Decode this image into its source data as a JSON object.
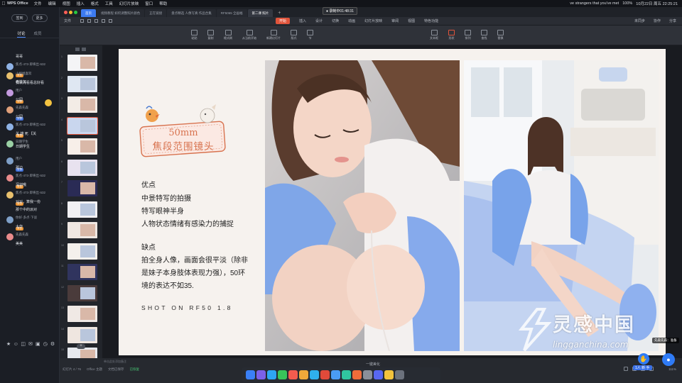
{
  "menubar": {
    "app_name": "WPS Office",
    "items": [
      "文件",
      "编辑",
      "视图",
      "插入",
      "格式",
      "工具",
      "幻灯片放映",
      "窗口",
      "帮助"
    ],
    "now_playing": "ve strangers that you've met",
    "battery": "100%",
    "clock": "10月22日 周五 22:25:21"
  },
  "sidebar": {
    "btn_left": "签到",
    "btn_right": "更多",
    "tabs": [
      "讨论",
      "成员"
    ],
    "messages": [
      {
        "user": "",
        "badge": "",
        "msg": "哥哥"
      },
      {
        "user": "焦点·473·即将出·632",
        "badge": "学员",
        "msg": "老铁加"
      },
      {
        "user": "小姐姐喜欢",
        "badge": "",
        "msg": ""
      },
      {
        "user": "",
        "badge": "",
        "msg": "我就先看看总好看"
      },
      {
        "user": "用户",
        "badge": "学员",
        "msg": ""
      },
      {
        "user": "",
        "badge": "",
        "msg": "公园"
      },
      {
        "user": "先森先森",
        "badge": "学员",
        "msg": ""
      },
      {
        "user": "",
        "badge": "",
        "msg": "公园"
      },
      {
        "user": "焦点·473·即将出·632",
        "badge": "学员",
        "msg": ""
      },
      {
        "user": "",
        "badge": "",
        "msg": "关 雄 死 【关"
      },
      {
        "user": "日期学生",
        "badge": "",
        "msg": "日期学生"
      },
      {
        "user": "",
        "badge": "",
        "msg": ""
      },
      {
        "user": "用户",
        "badge": "学员",
        "msg": ""
      },
      {
        "user": "",
        "badge": "",
        "msg": "那边"
      },
      {
        "user": "焦点·473·即将出·632",
        "badge": "学员",
        "msg": ""
      },
      {
        "user": "",
        "badge": "",
        "msg": "深圳哦"
      },
      {
        "user": "焦点·473·即将出·632",
        "badge": "学员",
        "msg": ""
      },
      {
        "user": "",
        "badge": "",
        "msg": "对对，算我一份"
      },
      {
        "user": "",
        "badge": "",
        "msg": "那个中的派对"
      },
      {
        "user": "你好·多点·下谈",
        "badge": "学员",
        "msg": ""
      },
      {
        "user": "",
        "badge": "",
        "msg": "大作"
      },
      {
        "user": "先森先森",
        "badge": "",
        "msg": ""
      },
      {
        "user": "",
        "badge": "",
        "msg": "美美"
      }
    ]
  },
  "tabs": {
    "home": "首页",
    "docs": [
      "视频教程 如何调整照片颜色",
      "正在链接",
      "盘点精选 人像写真 作品合集",
      "RF5065 全画幅",
      "第二课 照片"
    ],
    "recording": "● 录制中01:48:31"
  },
  "ribbon": {
    "tabs": [
      "文件",
      "开始",
      "插入",
      "设计",
      "切换",
      "动画",
      "幻灯片放映",
      "审阅",
      "视图",
      "特色功能"
    ],
    "start": "开始",
    "right": [
      "未同步",
      "协作",
      "分享"
    ],
    "tools": [
      "粘贴",
      "复制",
      "格式刷",
      "从当前开始",
      "新建幻灯片",
      "版式",
      "节",
      "文本框",
      "形状",
      "排列",
      "查找",
      "替换"
    ]
  },
  "thumbs": {
    "numbers": [
      "1",
      "2",
      "3",
      "4",
      "5",
      "6",
      "7",
      "8",
      "9",
      "10",
      "11",
      "12",
      "13",
      "14",
      "15"
    ],
    "add": "+"
  },
  "slide": {
    "stamp_line1": "50mm",
    "stamp_line2": "焦段范围镜头",
    "pros_title": "优点",
    "pros": [
      "中景特写的拍摄",
      "特写眼神半身",
      "人物状态情绪有感染力的捕捉"
    ],
    "cons_title": "缺点",
    "cons": [
      "拍全身人像，画面会很平淡（除非",
      "是妹子本身肢体表现力强），50环",
      "境的表达不如35."
    ],
    "shot": "SHOT ON RF50 1.8",
    "notes_hint": "单击此处添加备注"
  },
  "status": {
    "slide_info": "幻灯片 4 / 76",
    "theme": "Office 主题",
    "font": "文档已保存",
    "saved": "已恢复",
    "zoom": "111%"
  },
  "dock": {
    "label": "一键美化"
  },
  "overlay": {
    "viewer_count": "1人 新 手",
    "toast": "先森先森：准备",
    "watermark_cn": "灵感中国",
    "watermark_url": "lingganchina.com"
  },
  "colors": {
    "accent": "#e0543b",
    "blue": "#2f7bf6",
    "stamp": "#d8734f"
  }
}
